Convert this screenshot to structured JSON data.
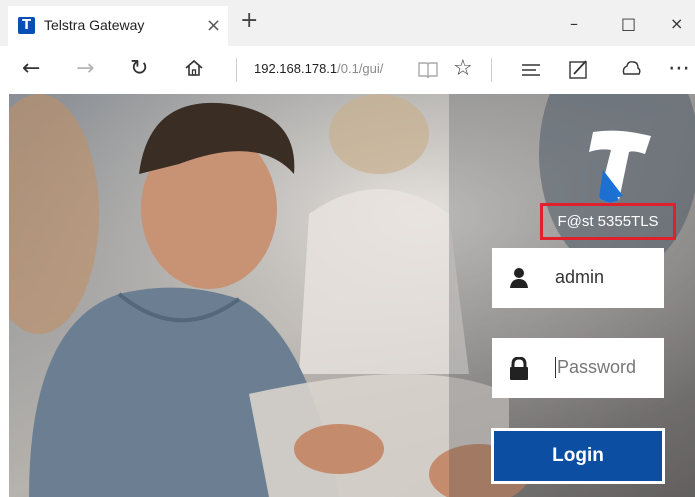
{
  "browser": {
    "tab_title": "Telstra Gateway",
    "tab_favicon": "T",
    "tab_close": "×",
    "new_tab": "+",
    "minimize": "–",
    "maximize": "□",
    "close": "×",
    "url_host": "192.168.178.1",
    "url_path": "/0.1/gui/"
  },
  "nav_icons": [
    "back-icon",
    "forward-icon",
    "refresh-icon",
    "home-icon",
    "reading-view-icon",
    "favorite-star-icon",
    "hub-icon",
    "web-note-icon",
    "share-icon",
    "more-icon"
  ],
  "login": {
    "model": "F@st 5355TLS",
    "username_value": "admin",
    "password_placeholder": "Password",
    "button_label": "Login"
  },
  "colors": {
    "brand_blue": "#0b4ea2",
    "highlight_red": "#e0202a"
  }
}
